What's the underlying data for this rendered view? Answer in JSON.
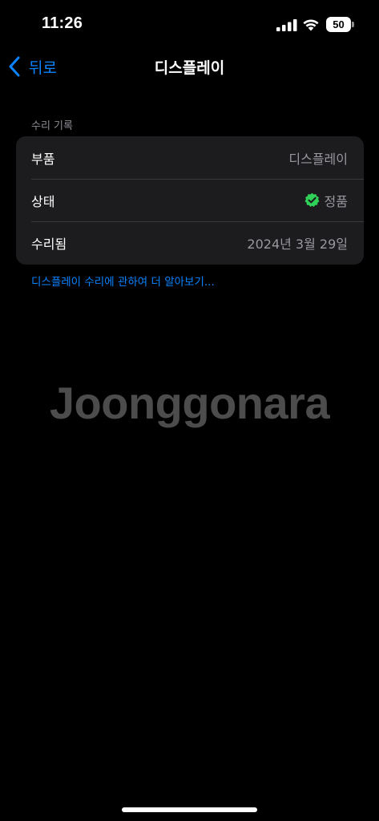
{
  "status_bar": {
    "time": "11:26",
    "battery_level": "50",
    "signal_icon": "cellular-signal-icon",
    "wifi_icon": "wifi-icon"
  },
  "nav": {
    "back_label": "뒤로",
    "back_icon": "chevron-left-icon",
    "title": "디스플레이"
  },
  "section": {
    "header": "수리 기록",
    "rows": [
      {
        "label": "부품",
        "value": "디스플레이"
      },
      {
        "label": "상태",
        "value": "정품",
        "icon": "checkmark-seal-icon"
      },
      {
        "label": "수리됨",
        "value": "2024년 3월 29일"
      }
    ],
    "learn_more": "디스플레이 수리에 관하여 더 알아보기..."
  },
  "watermark": "Joonggonara",
  "colors": {
    "accent": "#0a84ff",
    "check_green": "#30d158",
    "card_bg": "#1c1c1e",
    "secondary_text": "#98989f"
  }
}
